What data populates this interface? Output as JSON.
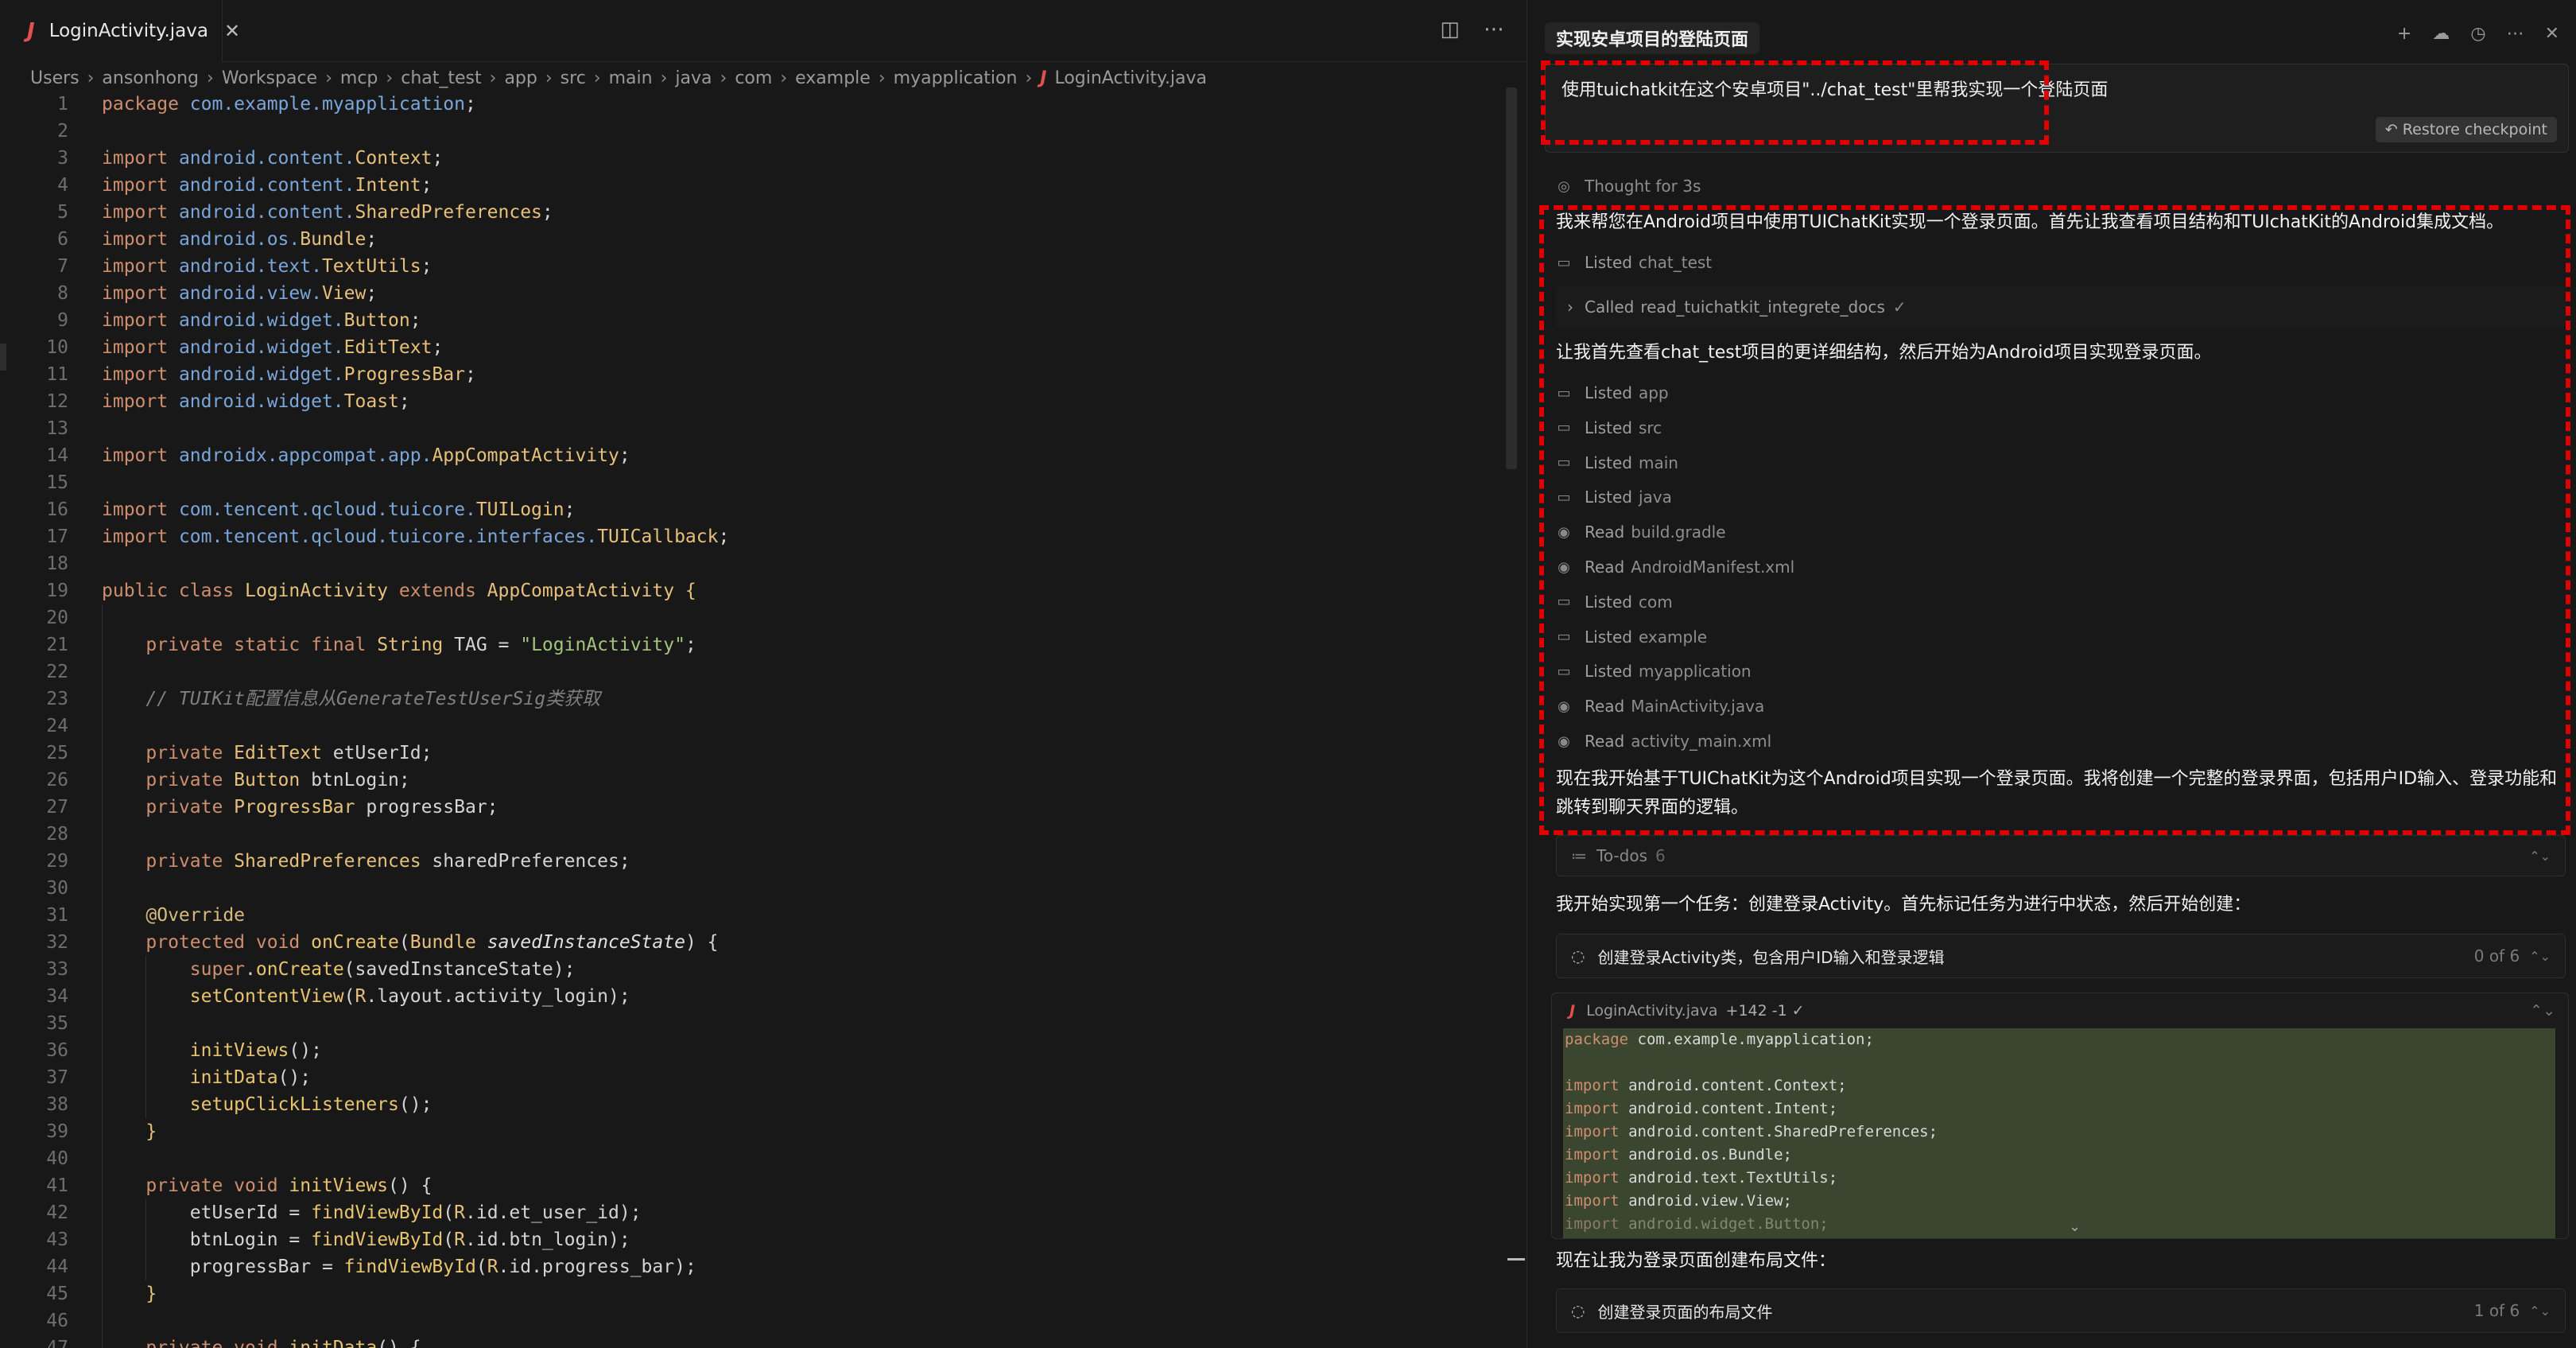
{
  "editor": {
    "tab": {
      "label": "LoginActivity.java",
      "close": "✕",
      "file_icon": "J"
    },
    "actions": {
      "split": "◫",
      "more": "⋯"
    },
    "breadcrumb": [
      "Users",
      "ansonhong",
      "Workspace",
      "mcp",
      "chat_test",
      "app",
      "src",
      "main",
      "java",
      "com",
      "example",
      "myapplication"
    ],
    "breadcrumb_file": "LoginActivity.java",
    "lines": [
      {
        "n": "1",
        "t": [
          [
            "kw",
            "package "
          ],
          [
            "pk",
            "com.example.myapplication"
          ],
          [
            "",
            "; "
          ]
        ]
      },
      {
        "n": "2",
        "t": []
      },
      {
        "n": "3",
        "t": [
          [
            "kw",
            "import "
          ],
          [
            "pk",
            "android.content."
          ],
          [
            "ty",
            "Context"
          ],
          [
            "",
            ";"
          ]
        ]
      },
      {
        "n": "4",
        "t": [
          [
            "kw",
            "import "
          ],
          [
            "pk",
            "android.content."
          ],
          [
            "ty",
            "Intent"
          ],
          [
            "",
            ";"
          ]
        ]
      },
      {
        "n": "5",
        "t": [
          [
            "kw",
            "import "
          ],
          [
            "pk",
            "android.content."
          ],
          [
            "ty",
            "SharedPreferences"
          ],
          [
            "",
            ";"
          ]
        ]
      },
      {
        "n": "6",
        "t": [
          [
            "kw",
            "import "
          ],
          [
            "pk",
            "android.os."
          ],
          [
            "ty",
            "Bundle"
          ],
          [
            "",
            ";"
          ]
        ]
      },
      {
        "n": "7",
        "t": [
          [
            "kw",
            "import "
          ],
          [
            "pk",
            "android.text."
          ],
          [
            "ty",
            "TextUtils"
          ],
          [
            "",
            ";"
          ]
        ]
      },
      {
        "n": "8",
        "t": [
          [
            "kw",
            "import "
          ],
          [
            "pk",
            "android.view."
          ],
          [
            "ty",
            "View"
          ],
          [
            "",
            ";"
          ]
        ]
      },
      {
        "n": "9",
        "t": [
          [
            "kw",
            "import "
          ],
          [
            "pk",
            "android.widget."
          ],
          [
            "ty",
            "Button"
          ],
          [
            "",
            ";"
          ]
        ]
      },
      {
        "n": "10",
        "t": [
          [
            "kw",
            "import "
          ],
          [
            "pk",
            "android.widget."
          ],
          [
            "ty",
            "EditText"
          ],
          [
            "",
            ";"
          ]
        ]
      },
      {
        "n": "11",
        "t": [
          [
            "kw",
            "import "
          ],
          [
            "pk",
            "android.widget."
          ],
          [
            "ty",
            "ProgressBar"
          ],
          [
            "",
            ";"
          ]
        ]
      },
      {
        "n": "12",
        "t": [
          [
            "kw",
            "import "
          ],
          [
            "pk",
            "android.widget."
          ],
          [
            "ty",
            "Toast"
          ],
          [
            "",
            ";"
          ]
        ]
      },
      {
        "n": "13",
        "t": []
      },
      {
        "n": "14",
        "t": [
          [
            "kw",
            "import "
          ],
          [
            "pk",
            "androidx.appcompat.app."
          ],
          [
            "ty",
            "AppCompatActivity"
          ],
          [
            "",
            ";"
          ]
        ]
      },
      {
        "n": "15",
        "t": []
      },
      {
        "n": "16",
        "t": [
          [
            "kw",
            "import "
          ],
          [
            "pk",
            "com.tencent.qcloud.tuicore."
          ],
          [
            "ty",
            "TUILogin"
          ],
          [
            "",
            ";"
          ]
        ]
      },
      {
        "n": "17",
        "t": [
          [
            "kw",
            "import "
          ],
          [
            "pk",
            "com.tencent.qcloud.tuicore.interfaces."
          ],
          [
            "ty",
            "TUICallback"
          ],
          [
            "",
            ";"
          ]
        ]
      },
      {
        "n": "18",
        "t": []
      },
      {
        "n": "19",
        "t": [
          [
            "kw",
            "public class "
          ],
          [
            "ty",
            "LoginActivity "
          ],
          [
            "kw",
            "extends "
          ],
          [
            "ty",
            "AppCompatActivity "
          ],
          [
            "fn",
            "{"
          ]
        ]
      },
      {
        "n": "20",
        "t": []
      },
      {
        "n": "21",
        "t": [
          [
            "",
            "    "
          ],
          [
            "kw",
            "private static final "
          ],
          [
            "ty",
            "String "
          ],
          [
            "fld",
            "TAG = "
          ],
          [
            "str",
            "\"LoginActivity\""
          ],
          [
            "",
            ";"
          ]
        ]
      },
      {
        "n": "22",
        "t": []
      },
      {
        "n": "23",
        "t": [
          [
            "",
            "    "
          ],
          [
            "cm",
            "// TUIKit配置信息从GenerateTestUserSig类获取"
          ]
        ]
      },
      {
        "n": "24",
        "t": []
      },
      {
        "n": "25",
        "t": [
          [
            "",
            "    "
          ],
          [
            "kw",
            "private "
          ],
          [
            "ty",
            "EditText "
          ],
          [
            "fld",
            "etUserId;"
          ]
        ]
      },
      {
        "n": "26",
        "t": [
          [
            "",
            "    "
          ],
          [
            "kw",
            "private "
          ],
          [
            "ty",
            "Button "
          ],
          [
            "fld",
            "btnLogin;"
          ]
        ]
      },
      {
        "n": "27",
        "t": [
          [
            "",
            "    "
          ],
          [
            "kw",
            "private "
          ],
          [
            "ty",
            "ProgressBar "
          ],
          [
            "fld",
            "progressBar;"
          ]
        ]
      },
      {
        "n": "28",
        "t": []
      },
      {
        "n": "29",
        "t": [
          [
            "",
            "    "
          ],
          [
            "kw",
            "private "
          ],
          [
            "ty",
            "SharedPreferences "
          ],
          [
            "fld",
            "sharedPreferences;"
          ]
        ]
      },
      {
        "n": "30",
        "t": []
      },
      {
        "n": "31",
        "t": [
          [
            "",
            "    "
          ],
          [
            "an",
            "@Override"
          ]
        ]
      },
      {
        "n": "32",
        "t": [
          [
            "",
            "    "
          ],
          [
            "kw",
            "protected void "
          ],
          [
            "mth",
            "onCreate"
          ],
          [
            "",
            "("
          ],
          [
            "ty",
            "Bundle "
          ],
          [
            "pm",
            "savedInstanceState"
          ],
          [
            "",
            ") {"
          ]
        ]
      },
      {
        "n": "33",
        "t": [
          [
            "",
            "        "
          ],
          [
            "kw",
            "super"
          ],
          [
            "",
            "."
          ],
          [
            "mth",
            "onCreate"
          ],
          [
            "",
            "(savedInstanceState);"
          ]
        ]
      },
      {
        "n": "34",
        "t": [
          [
            "",
            "        "
          ],
          [
            "mth",
            "setContentView"
          ],
          [
            "",
            "("
          ],
          [
            "ty",
            "R"
          ],
          [
            "",
            ".layout.activity_login);"
          ]
        ]
      },
      {
        "n": "35",
        "t": []
      },
      {
        "n": "36",
        "t": [
          [
            "",
            "        "
          ],
          [
            "mth",
            "initViews"
          ],
          [
            "",
            "();"
          ]
        ]
      },
      {
        "n": "37",
        "t": [
          [
            "",
            "        "
          ],
          [
            "mth",
            "initData"
          ],
          [
            "",
            "();"
          ]
        ]
      },
      {
        "n": "38",
        "t": [
          [
            "",
            "        "
          ],
          [
            "mth",
            "setupClickListeners"
          ],
          [
            "",
            "();"
          ]
        ]
      },
      {
        "n": "39",
        "t": [
          [
            "",
            "    "
          ],
          [
            "fn",
            "}"
          ]
        ]
      },
      {
        "n": "40",
        "t": []
      },
      {
        "n": "41",
        "t": [
          [
            "",
            "    "
          ],
          [
            "kw",
            "private void "
          ],
          [
            "mth",
            "initViews"
          ],
          [
            "",
            "() {"
          ]
        ]
      },
      {
        "n": "42",
        "t": [
          [
            "",
            "        "
          ],
          [
            "fld",
            "etUserId = "
          ],
          [
            "mth",
            "findViewById"
          ],
          [
            "",
            "("
          ],
          [
            "ty",
            "R"
          ],
          [
            "",
            ".id.et_user_id);"
          ]
        ]
      },
      {
        "n": "43",
        "t": [
          [
            "",
            "        "
          ],
          [
            "fld",
            "btnLogin = "
          ],
          [
            "mth",
            "findViewById"
          ],
          [
            "",
            "("
          ],
          [
            "ty",
            "R"
          ],
          [
            "",
            ".id.btn_login);"
          ]
        ]
      },
      {
        "n": "44",
        "t": [
          [
            "",
            "        "
          ],
          [
            "fld",
            "progressBar = "
          ],
          [
            "mth",
            "findViewById"
          ],
          [
            "",
            "("
          ],
          [
            "ty",
            "R"
          ],
          [
            "",
            ".id.progress_bar);"
          ]
        ]
      },
      {
        "n": "45",
        "t": [
          [
            "",
            "    "
          ],
          [
            "fn",
            "}"
          ]
        ]
      },
      {
        "n": "46",
        "t": []
      },
      {
        "n": "47",
        "t": [
          [
            "",
            "    "
          ],
          [
            "kw",
            "private void "
          ],
          [
            "mth",
            "initData"
          ],
          [
            "",
            "() {"
          ]
        ]
      }
    ]
  },
  "chat": {
    "title": "实现安卓项目的登陆页面",
    "actions": {
      "new": "+",
      "cloud": "☁",
      "history": "◷",
      "more": "⋯",
      "close": "✕"
    },
    "user_message": "使用tuichatkit在这个安卓项目\"../chat_test\"里帮我实现一个登陆页面",
    "restore_checkpoint": "Restore checkpoint",
    "restore_icon": "↶",
    "thought": "Thought for 3s",
    "thought_icon": "◎",
    "prose_1": "我来帮您在Android项目中使用TUIChatKit实现一个登录页面。首先让我查看项目结构和TUIchatKit的Android集成文档。",
    "listed_chat_test": {
      "verb": "Listed",
      "target": "chat_test"
    },
    "called": {
      "verb": "Called",
      "target": "read_tuichatkit_integrete_docs",
      "check": "✓",
      "chevron": "›"
    },
    "prose_2": "让我首先查看chat_test项目的更详细结构，然后开始为Android项目实现登录页面。",
    "tool_rows": [
      {
        "icon": "folder-icon",
        "glyph": "▭",
        "verb": "Listed",
        "target": "app"
      },
      {
        "icon": "folder-icon",
        "glyph": "▭",
        "verb": "Listed",
        "target": "src"
      },
      {
        "icon": "folder-icon",
        "glyph": "▭",
        "verb": "Listed",
        "target": "main"
      },
      {
        "icon": "folder-icon",
        "glyph": "▭",
        "verb": "Listed",
        "target": "java"
      },
      {
        "icon": "eye-icon",
        "glyph": "◉",
        "verb": "Read",
        "target": "build.gradle"
      },
      {
        "icon": "eye-icon",
        "glyph": "◉",
        "verb": "Read",
        "target": "AndroidManifest.xml"
      },
      {
        "icon": "folder-icon",
        "glyph": "▭",
        "verb": "Listed",
        "target": "com"
      },
      {
        "icon": "folder-icon",
        "glyph": "▭",
        "verb": "Listed",
        "target": "example"
      },
      {
        "icon": "folder-icon",
        "glyph": "▭",
        "verb": "Listed",
        "target": "myapplication"
      },
      {
        "icon": "eye-icon",
        "glyph": "◉",
        "verb": "Read",
        "target": "MainActivity.java"
      },
      {
        "icon": "eye-icon",
        "glyph": "◉",
        "verb": "Read",
        "target": "activity_main.xml"
      }
    ],
    "prose_3": "现在我开始基于TUIChatKit为这个Android项目实现一个登录页面。我将创建一个完整的登录界面，包括用户ID输入、登录功能和跳转到聊天界面的逻辑。",
    "todos": {
      "label": "To-dos",
      "count": "6",
      "icon": "≔",
      "toggle": "⌃⌄"
    },
    "prose_4": "我开始实现第一个任务：创建登录Activity。首先标记任务为进行中状态，然后开始创建：",
    "task_1": {
      "label": "创建登录Activity类，包含用户ID输入和登录逻辑",
      "progress": "0 of 6",
      "spinner": "◌",
      "toggle": "⌃⌄"
    },
    "diff": {
      "file": "LoginActivity.java",
      "stat": "+142 -1 ✓",
      "chevron": "⌃⌄",
      "expand": "⌄",
      "lines": [
        {
          "k": "package",
          "r": " com.example.myapplication;"
        },
        {
          "k": "",
          "r": ""
        },
        {
          "k": "import",
          "r": " android.content.Context;"
        },
        {
          "k": "import",
          "r": " android.content.Intent;"
        },
        {
          "k": "import",
          "r": " android.content.SharedPreferences;"
        },
        {
          "k": "import",
          "r": " android.os.Bundle;"
        },
        {
          "k": "import",
          "r": " android.text.TextUtils;"
        },
        {
          "k": "import",
          "r": " android.view.View;"
        },
        {
          "k": "import",
          "r": " android.widget.Button;"
        }
      ]
    },
    "prose_5": "现在让我为登录页面创建布局文件：",
    "task_2": {
      "label": "创建登录页面的布局文件",
      "progress": "1 of 6",
      "spinner": "◌",
      "toggle": "⌃⌄"
    }
  }
}
